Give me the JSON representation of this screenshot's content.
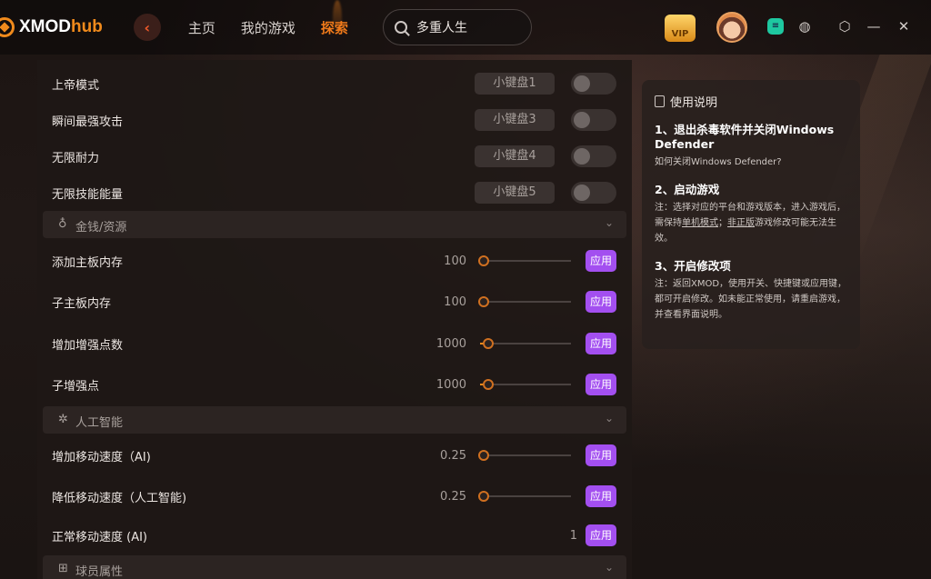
{
  "app": {
    "logo_main": "XMOD",
    "logo_hub": "hub"
  },
  "nav": {
    "items": [
      "主页",
      "我的游戏",
      "探索"
    ],
    "active": "探索"
  },
  "search": {
    "value": "多重人生"
  },
  "vip": {
    "label": "VIP"
  },
  "colors": {
    "accent": "#f08a1c",
    "apply": "#a34ff0",
    "active_nav": "#f07a1a"
  },
  "mods_toggle": [
    {
      "label": "上帝模式",
      "hotkey": "小键盘1"
    },
    {
      "label": "瞬间最强攻击",
      "hotkey": "小键盘3"
    },
    {
      "label": "无限耐力",
      "hotkey": "小键盘4"
    },
    {
      "label": "无限技能能量",
      "hotkey": "小键盘5"
    }
  ],
  "sections": [
    {
      "icon": "money-bag-icon",
      "label": "金钱/资源"
    },
    {
      "icon": "ai-icon",
      "label": "人工智能"
    },
    {
      "icon": "grid-icon",
      "label": "球员属性"
    }
  ],
  "money_mods": [
    {
      "label": "添加主板内存",
      "value": "100",
      "level": 0.0
    },
    {
      "label": "子主板内存",
      "value": "100",
      "level": 0.0
    },
    {
      "label": "增加增强点数",
      "value": "1000",
      "level": 0.05
    },
    {
      "label": "子增强点",
      "value": "1000",
      "level": 0.05
    }
  ],
  "ai_mods": [
    {
      "label": "增加移动速度（AI)",
      "value": "0.25",
      "level": 0.0
    },
    {
      "label": "降低移动速度（人工智能)",
      "value": "0.25",
      "level": 0.0
    },
    {
      "label": "正常移动速度 (AI)",
      "value": "1"
    }
  ],
  "apply_label": "应用",
  "info": {
    "title": "使用说明",
    "step1_title": "1、退出杀毒软件并关闭Windows Defender",
    "step1_text": "如何关闭Windows Defender?",
    "step2_title": "2、启动游戏",
    "step2_text_a": "注：选择对应的平台和游戏版本，进入游戏后，需保持",
    "step2_link1": "单机模式",
    "step2_text_b": "；",
    "step2_link2": "非正版",
    "step2_text_c": "游戏修改可能无法生效。",
    "step3_title": "3、开启修改项",
    "step3_text": "注：返回XMOD，使用开关、快捷键或应用键，都可开启修改。如未能正常使用，请重启游戏，并查看界面说明。"
  }
}
